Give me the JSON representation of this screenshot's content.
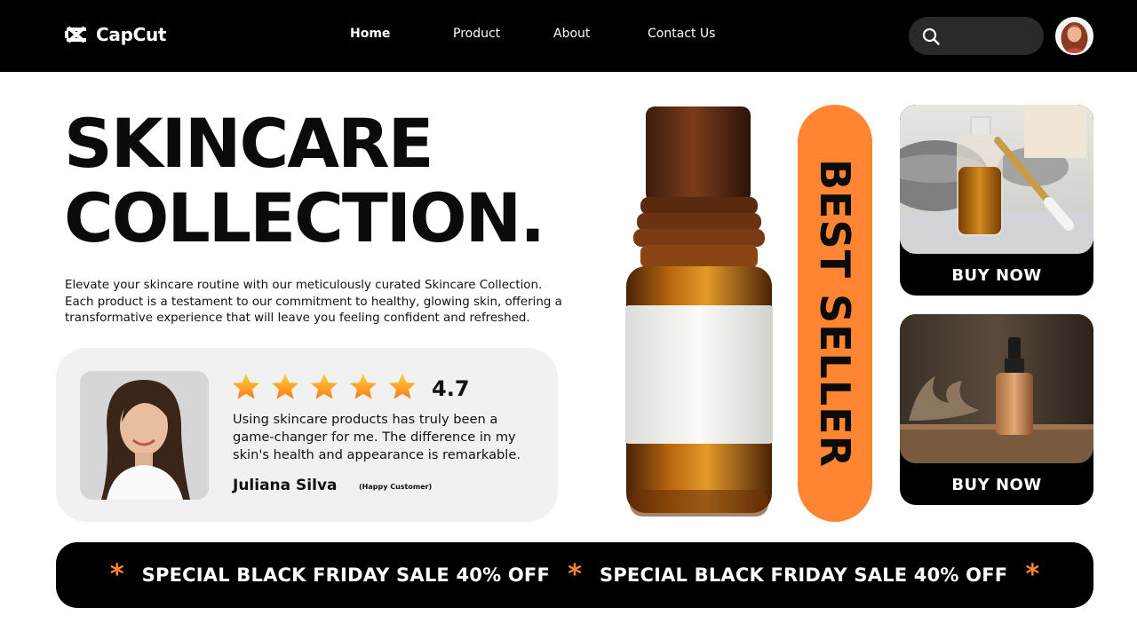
{
  "nav": {
    "brand": "CapCut",
    "links": [
      {
        "label": "Home",
        "active": true
      },
      {
        "label": "Product",
        "active": false
      },
      {
        "label": "About",
        "active": false
      },
      {
        "label": "Contact Us",
        "active": false
      }
    ],
    "search_icon": "search-icon"
  },
  "hero": {
    "title_line1": "SKINCARE",
    "title_line2": "COLLECTION.",
    "description": "Elevate your skincare routine with our meticulously curated Skincare Collection. Each product is a testament to our commitment to healthy, glowing skin, offering a transformative experience that will leave you feeling confident and refreshed."
  },
  "testimonial": {
    "rating": "4.7",
    "stars": 5,
    "quote": "Using skincare products has truly been a game-changer for me. The difference in my skin's health and appearance is remarkable.",
    "name": "Juliana Silva",
    "role": "(Happy Customer)"
  },
  "badge": {
    "text": "BEST SELLER"
  },
  "cards": [
    {
      "button": "BUY NOW"
    },
    {
      "button": "BUY NOW"
    }
  ],
  "sale": {
    "text1": "SPECIAL BLACK FRIDAY SALE 40% OFF",
    "text2": "SPECIAL BLACK FRIDAY SALE 40% OFF",
    "star": "*"
  },
  "colors": {
    "accent": "#ff8533",
    "dark": "#000000",
    "panel": "#f1f1f1"
  }
}
